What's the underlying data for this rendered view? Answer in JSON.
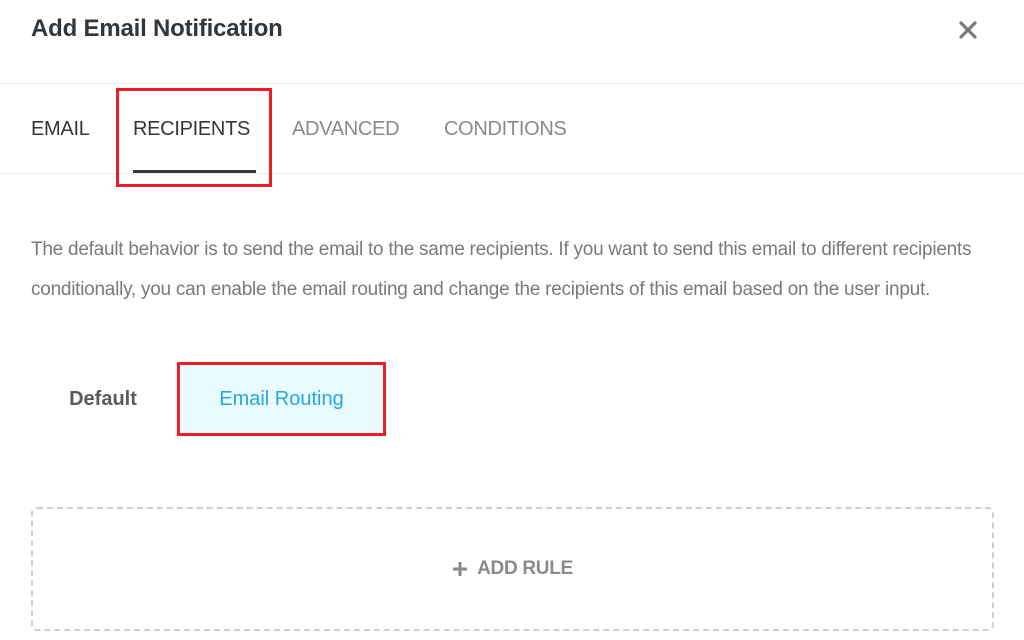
{
  "modal": {
    "title": "Add Email Notification",
    "close_icon": "close-icon"
  },
  "tabs": [
    {
      "label": "EMAIL",
      "active": false
    },
    {
      "label": "RECIPIENTS",
      "active": true
    },
    {
      "label": "ADVANCED",
      "active": false
    },
    {
      "label": "CONDITIONS",
      "active": false
    }
  ],
  "recipients": {
    "description": "The default behavior is to send the email to the same recipients. If you want to send this email to different recipients conditionally, you can enable the email routing and change the recipients of this email based on the user input.",
    "mode_options": [
      {
        "label": "Default",
        "selected": false
      },
      {
        "label": "Email Routing",
        "selected": true
      }
    ],
    "add_rule": {
      "icon": "plus-icon",
      "label": "ADD RULE"
    }
  },
  "colors": {
    "title": "#32373c",
    "accent": "#2ea6dc",
    "selected_bg": "#e8fbff",
    "muted_text": "#7a7a7a",
    "annotation": "#ee1c25"
  }
}
